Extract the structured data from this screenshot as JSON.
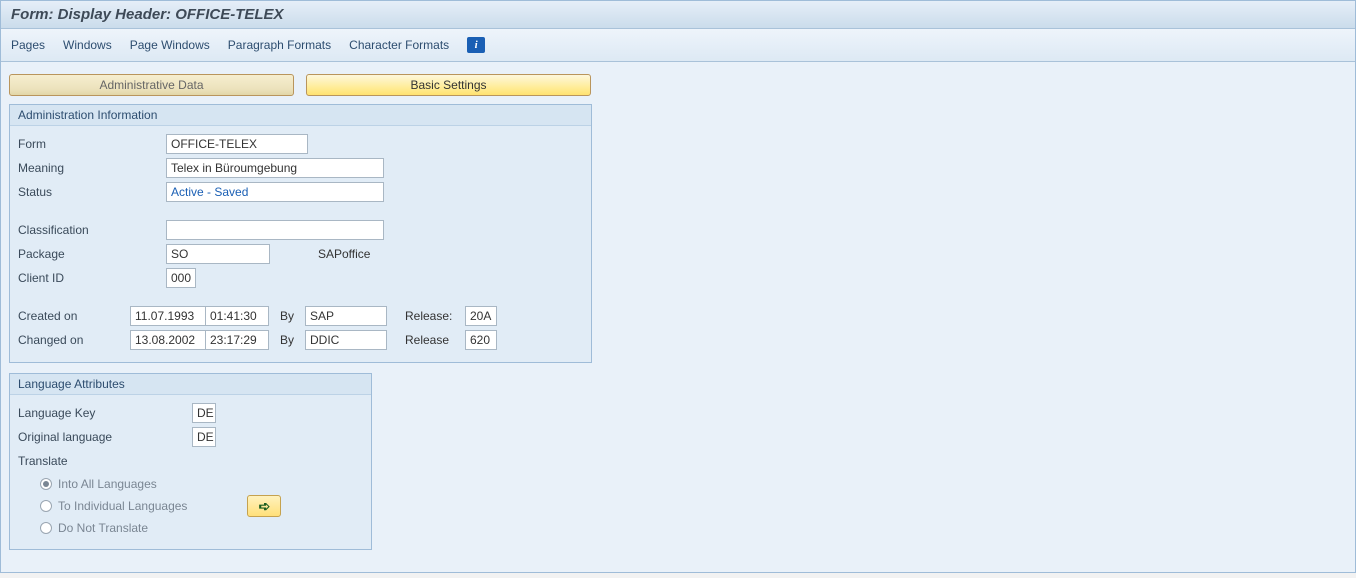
{
  "title": "Form: Display Header: OFFICE-TELEX",
  "toolbar": {
    "pages": "Pages",
    "windows": "Windows",
    "page_windows": "Page Windows",
    "paragraph_formats": "Paragraph Formats",
    "character_formats": "Character Formats"
  },
  "tabs": {
    "admin_data": "Administrative Data",
    "basic_settings": "Basic Settings"
  },
  "admin_panel": {
    "title": "Administration Information",
    "form_label": "Form",
    "form_value": "OFFICE-TELEX",
    "meaning_label": "Meaning",
    "meaning_value": "Telex in Büroumgebung",
    "status_label": "Status",
    "status_value": "Active - Saved",
    "classification_label": "Classification",
    "classification_value": "",
    "package_label": "Package",
    "package_value": "SO",
    "package_desc": "SAPoffice",
    "client_id_label": "Client ID",
    "client_id_value": "000",
    "created_on_label": "Created on",
    "created_date": "11.07.1993",
    "created_time": "01:41:30",
    "by1_label": "By",
    "created_by": "SAP",
    "release1_label": "Release:",
    "release1_value": "20A",
    "changed_on_label": "Changed on",
    "changed_date": "13.08.2002",
    "changed_time": "23:17:29",
    "by2_label": "By",
    "changed_by": "DDIC",
    "release2_label": "Release",
    "release2_value": "620"
  },
  "lang_panel": {
    "title": "Language Attributes",
    "lang_key_label": "Language Key",
    "lang_key_value": "DE",
    "orig_lang_label": "Original language",
    "orig_lang_value": "DE",
    "translate_label": "Translate",
    "opt_all": "Into All Languages",
    "opt_individual": "To Individual Languages",
    "opt_none": "Do Not Translate"
  }
}
